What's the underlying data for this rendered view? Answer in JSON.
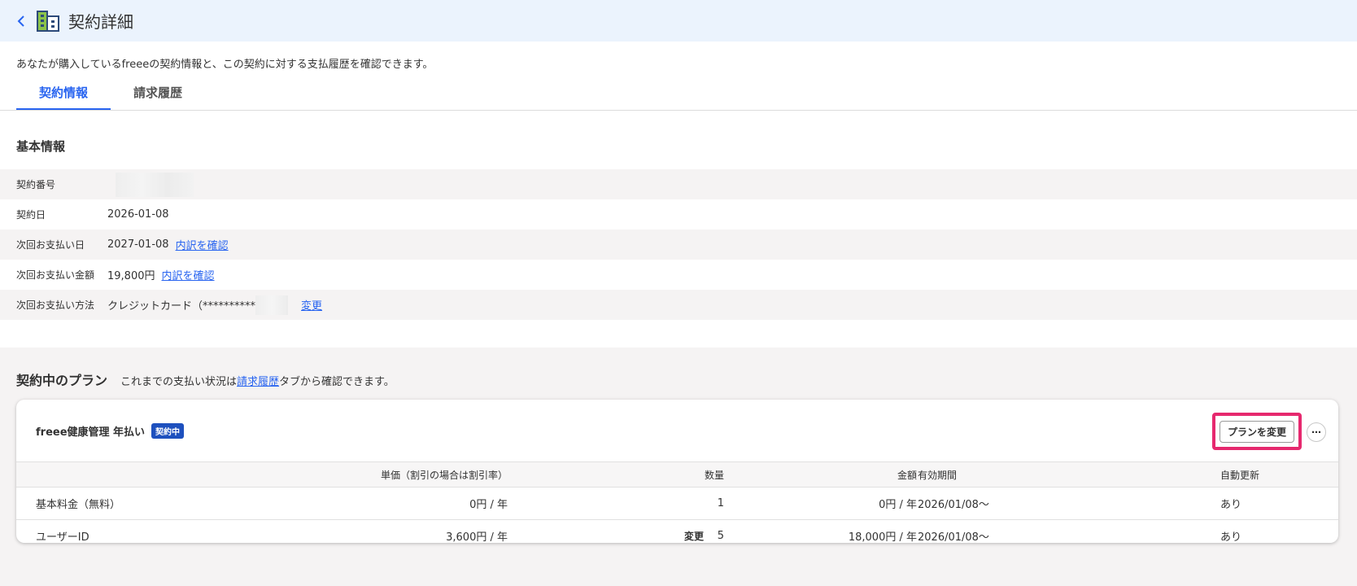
{
  "header": {
    "title": "契約詳細",
    "back_icon": "chevron-left-icon",
    "page_icon": "building-icon"
  },
  "description": "あなたが購入しているfreeeの契約情報と、この契約に対する支払履歴を確認できます。",
  "tabs": [
    {
      "label": "契約情報",
      "active": true
    },
    {
      "label": "請求履歴",
      "active": false
    }
  ],
  "basic_info": {
    "title": "基本情報",
    "rows": {
      "contract_number": {
        "label": "契約番号"
      },
      "contract_date": {
        "label": "契約日",
        "value": "2026-01-08"
      },
      "next_payment_date": {
        "label": "次回お支払い日",
        "value": "2027-01-08",
        "link": "内訳を確認"
      },
      "next_payment_amount": {
        "label": "次回お支払い金額",
        "value": "19,800円",
        "link": "内訳を確認"
      },
      "payment_method": {
        "label": "次回お支払い方法",
        "value": "クレジットカード（**********",
        "link": "変更"
      }
    }
  },
  "plans": {
    "title": "契約中のプラン",
    "note_prefix": "これまでの支払い状況は",
    "note_link": "請求履歴",
    "note_suffix": "タブから確認できます。",
    "card": {
      "plan_name": "freee健康管理 年払い",
      "badge": "契約中",
      "change_plan_button": "プランを変更",
      "more_button": "⋯",
      "columns": {
        "price": "単価（割引の場合は割引率）",
        "qty": "数量",
        "amount": "金額",
        "period": "有効期間",
        "auto_renew": "自動更新"
      },
      "rows": [
        {
          "name": "基本料金（無料）",
          "price": "0円 / 年",
          "edit": "",
          "qty": "1",
          "amount": "0円 / 年",
          "period": "2026/01/08〜",
          "auto_renew": "あり"
        },
        {
          "name": "ユーザーID",
          "price": "3,600円 / 年",
          "edit": "変更",
          "qty": "5",
          "amount": "18,000円 / 年",
          "period": "2026/01/08〜",
          "auto_renew": "あり"
        }
      ]
    }
  },
  "colors": {
    "accent": "#2864f0",
    "badge": "#1e50be",
    "highlight": "#e6286e",
    "header_bg": "#ebf3fd"
  }
}
